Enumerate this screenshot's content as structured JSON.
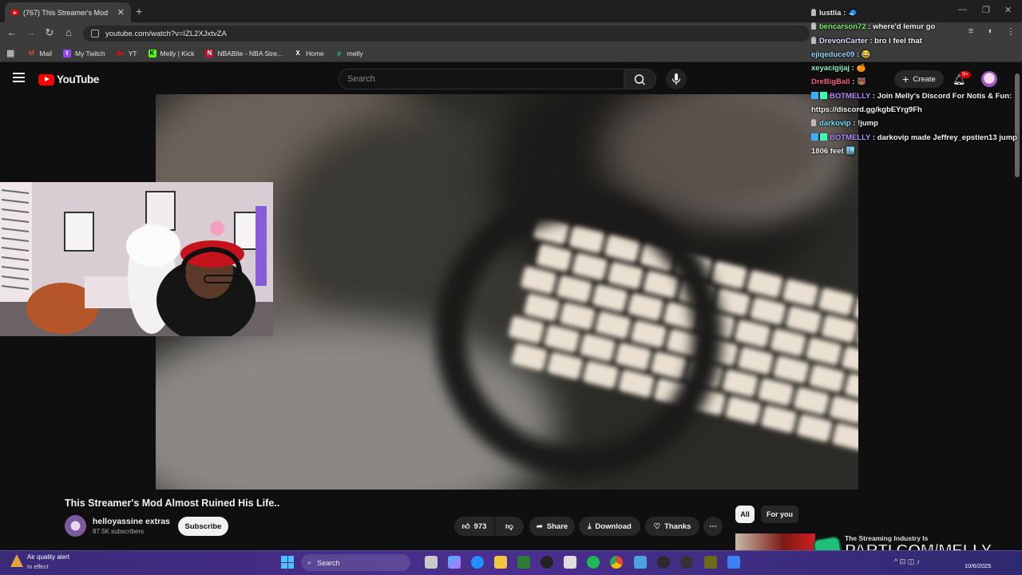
{
  "browser": {
    "tab_title": "(767) This Streamer's Mod",
    "new_tab": "+",
    "url": "youtube.com/watch?v=IZL2XJxtvZA",
    "bookmarks": [
      {
        "label": "Mail",
        "color": "#ea4335",
        "glyph": "M"
      },
      {
        "label": "My Twitch",
        "color": "#9146ff",
        "glyph": "t"
      },
      {
        "label": "YT",
        "color": "#ff0000",
        "glyph": "▶"
      },
      {
        "label": "Melly | Kick",
        "color": "#53fc18",
        "glyph": "K"
      },
      {
        "label": "NBABite - NBA Stre...",
        "color": "#c8102e",
        "glyph": "N"
      },
      {
        "label": "Home",
        "color": "#ffffff",
        "glyph": "X"
      },
      {
        "label": "melly",
        "color": "#1fbf7a",
        "glyph": "p"
      }
    ]
  },
  "youtube": {
    "logo_text": "YouTube",
    "search_placeholder": "Search",
    "create_label": "Create",
    "notification_count": "9+",
    "video_title": "This Streamer's Mod Almost Ruined His Life..",
    "channel_name": "helloyassine extras",
    "subscribers": "87.5K subscribers",
    "subscribe_label": "Subscribe",
    "like_count": "973",
    "share_label": "Share",
    "download_label": "Download",
    "thanks_label": "Thanks",
    "chips": [
      "All",
      "For you"
    ],
    "rec_title": "The Streaming Industry Is"
  },
  "chat": [
    {
      "user": "lustlia",
      "text": "🧢",
      "color": "#f4f4f4",
      "badge": "user"
    },
    {
      "user": "bencarson72",
      "text": "where'd lemur go",
      "color": "#7cf06b",
      "badge": "user"
    },
    {
      "user": "DrevonCarter",
      "text": "bro i feel that",
      "color": "#e3d8ff",
      "badge": "user"
    },
    {
      "user": "ejiqeduce09",
      "text": "😂",
      "color": "#9ad7ff",
      "badge": "none"
    },
    {
      "user": "xeyacigijaj",
      "text": "🍊",
      "color": "#8ff0c4",
      "badge": "none"
    },
    {
      "user": "DreBigBall",
      "text": "🐻",
      "color": "#ff5a7a",
      "badge": "none"
    },
    {
      "user": "BOTMELLY",
      "text": "Join Melly's Discord For Notis & Fun: https://discord.gg/kgbEYrg9Fh",
      "color": "#b58cff",
      "badge": "bot"
    },
    {
      "user": "darkovip",
      "text": "!jump",
      "color": "#6fe3ff",
      "badge": "user"
    },
    {
      "user": "BOTMELLY",
      "text": "darkovip made Jeffrey_epstien13 jump 1806 feet 🏙️",
      "color": "#b58cff",
      "badge": "bot"
    }
  ],
  "overlay": {
    "parti_text": "PARTI.COM/MELLY"
  },
  "taskbar": {
    "alert_title": "Air quality alert",
    "alert_sub": "In effect",
    "search_label": "Search",
    "date": "10/6/2025"
  }
}
